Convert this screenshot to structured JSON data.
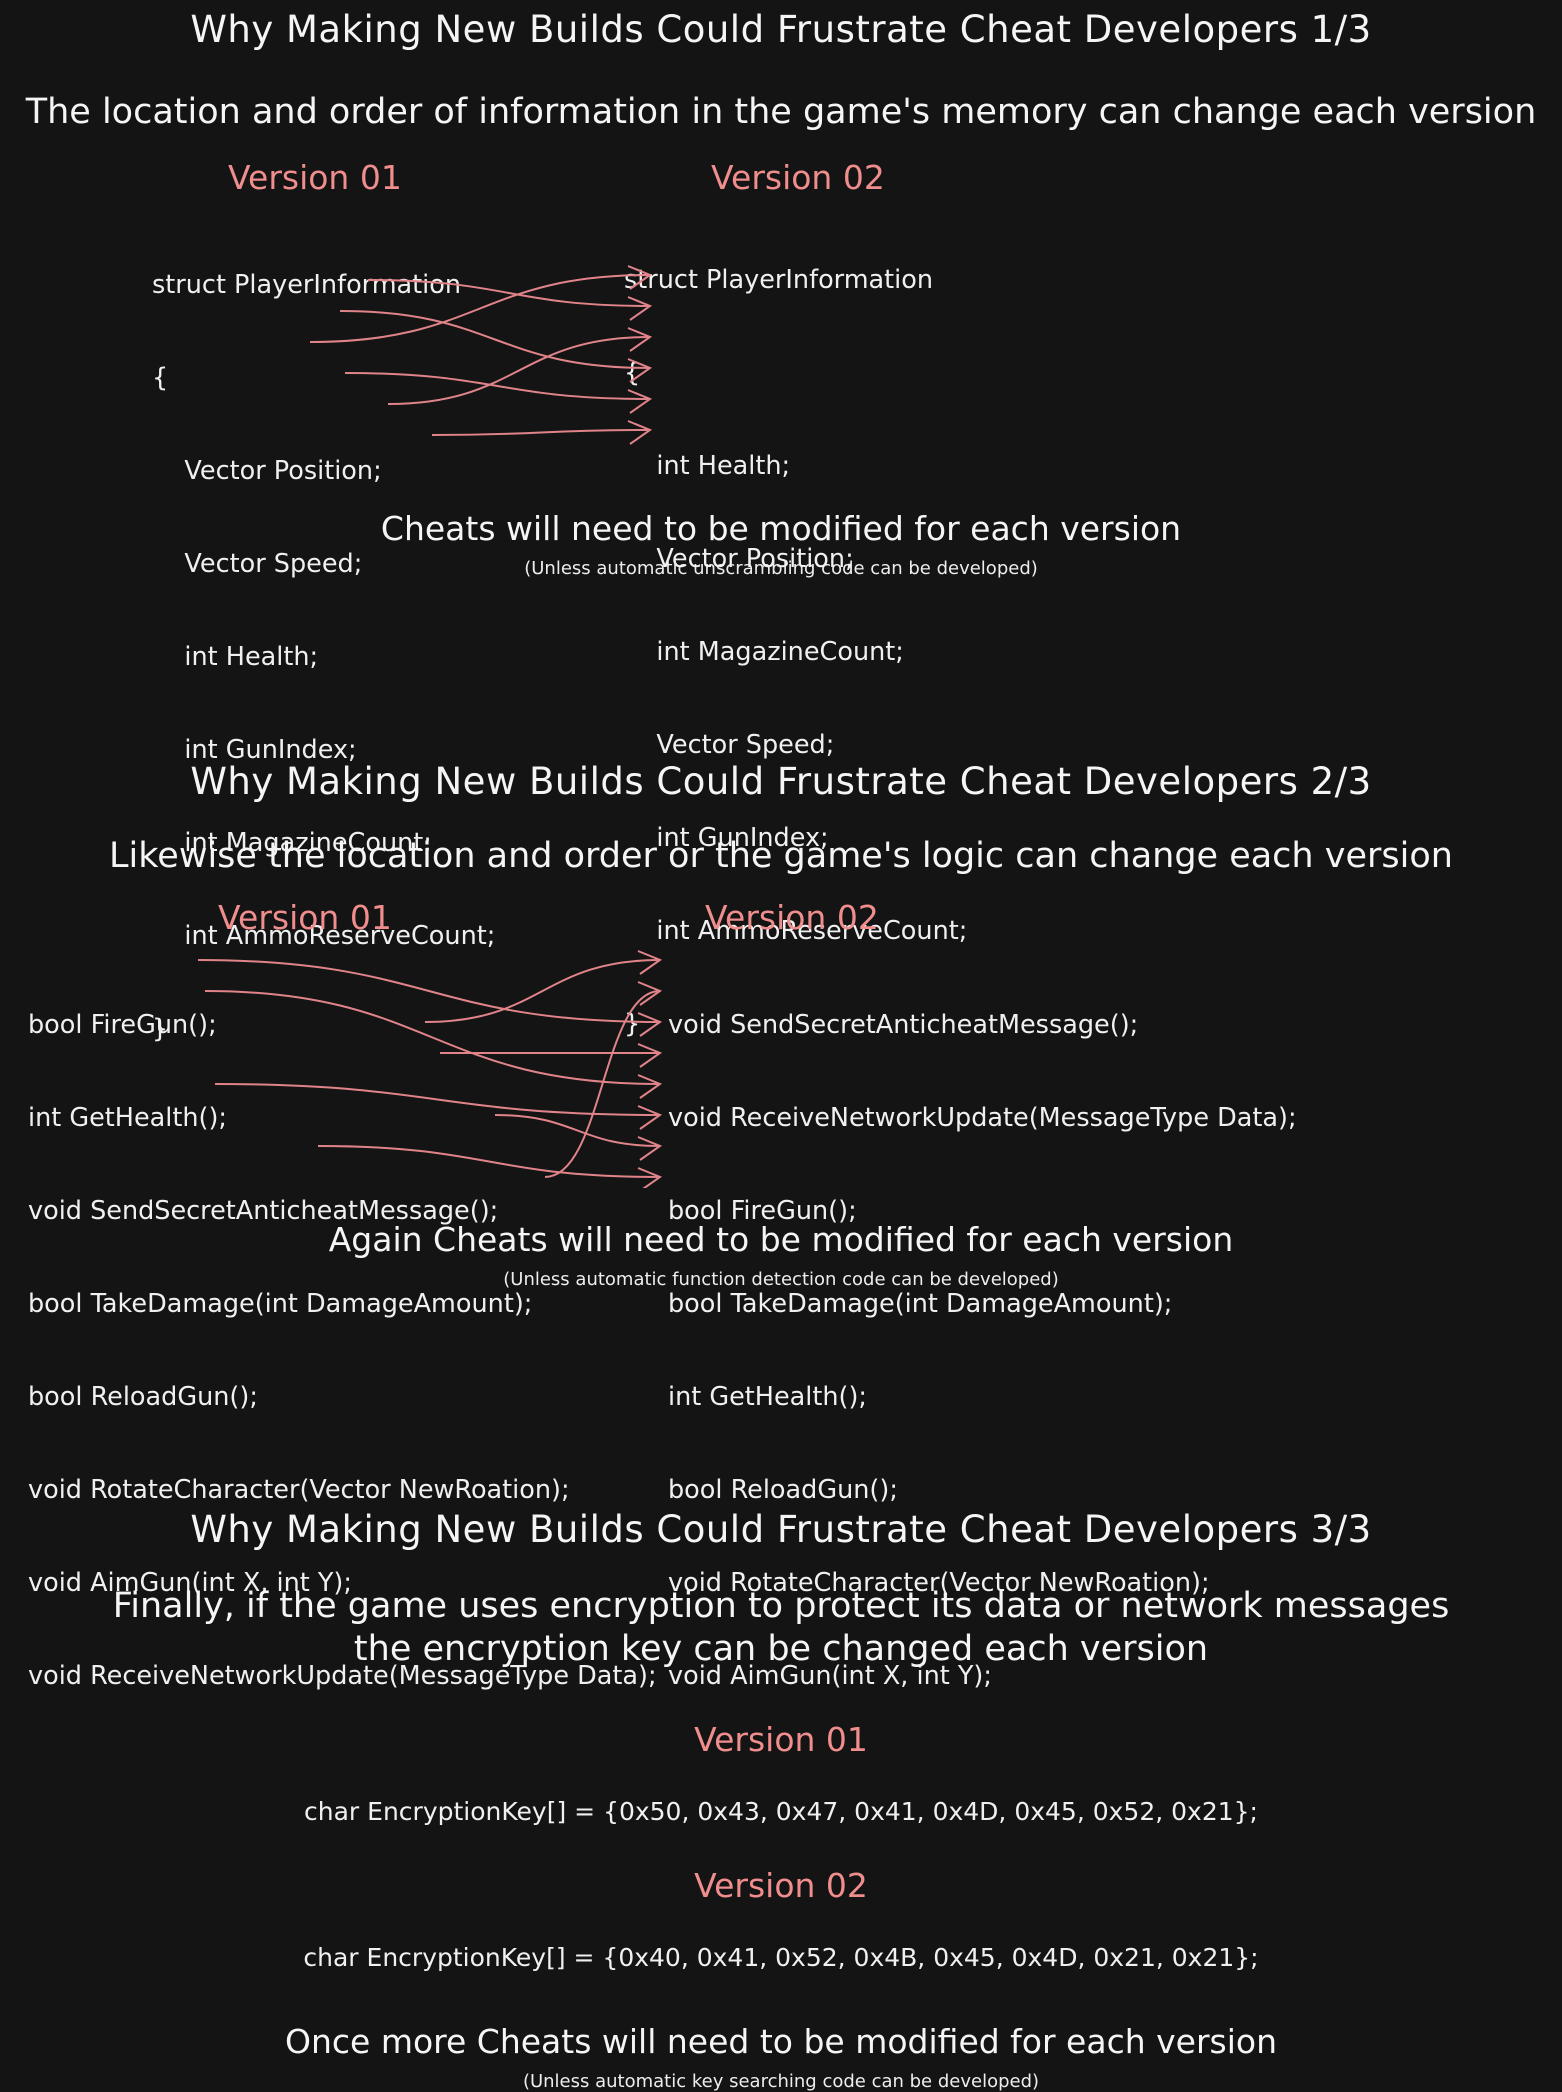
{
  "theme": {
    "background": "#141414",
    "text_color": "#f2f2f2",
    "accent_color": "#f08d8d",
    "arrow_color": "#e0848a"
  },
  "sections": [
    {
      "id": "section-1",
      "title": "Why Making New Builds Could Frustrate Cheat Developers 1/3",
      "subtitle": "The location and order of information in the game's memory can change each version",
      "version_left_label": "Version 01",
      "version_right_label": "Version 02",
      "left_code": [
        "struct PlayerInformation",
        "{",
        "    Vector Position;",
        "    Vector Speed;",
        "    int Health;",
        "    int GunIndex;",
        "    int MagazineCount;",
        "    int AmmoReserveCount;",
        "}"
      ],
      "right_code": [
        "struct PlayerInformation",
        "{",
        "    int Health;",
        "    Vector Position;",
        "    int MagazineCount;",
        "    Vector Speed;",
        "    int GunIndex;",
        "    int AmmoReserveCount;",
        "}"
      ],
      "mapping": [
        {
          "from": 0,
          "to": 1
        },
        {
          "from": 1,
          "to": 3
        },
        {
          "from": 2,
          "to": 0
        },
        {
          "from": 3,
          "to": 4
        },
        {
          "from": 4,
          "to": 2
        },
        {
          "from": 5,
          "to": 5
        }
      ],
      "conclusion": "Cheats will need to be modified for each version",
      "note": "(Unless automatic unscrambling code can be developed)"
    },
    {
      "id": "section-2",
      "title": "Why Making New Builds Could Frustrate Cheat Developers 2/3",
      "subtitle": "Likewise the location and order or the game's logic can change each version",
      "version_left_label": "Version 01",
      "version_right_label": "Version 02",
      "left_code": [
        "bool FireGun();",
        "int GetHealth();",
        "void SendSecretAnticheatMessage();",
        "bool TakeDamage(int DamageAmount);",
        "bool ReloadGun();",
        "void RotateCharacter(Vector NewRoation);",
        "void AimGun(int X, int Y);",
        "void ReceiveNetworkUpdate(MessageType Data);"
      ],
      "right_code": [
        "void SendSecretAnticheatMessage();",
        "void ReceiveNetworkUpdate(MessageType Data);",
        "bool FireGun();",
        "bool TakeDamage(int DamageAmount);",
        "int GetHealth();",
        "bool ReloadGun();",
        "void RotateCharacter(Vector NewRoation);",
        "void AimGun(int X, int Y);"
      ],
      "mapping": [
        {
          "from": 0,
          "to": 2
        },
        {
          "from": 1,
          "to": 4
        },
        {
          "from": 2,
          "to": 0
        },
        {
          "from": 3,
          "to": 3
        },
        {
          "from": 4,
          "to": 5
        },
        {
          "from": 5,
          "to": 6
        },
        {
          "from": 6,
          "to": 7
        },
        {
          "from": 7,
          "to": 1
        }
      ],
      "conclusion": "Again Cheats will need to be modified for each version",
      "note": "(Unless automatic function detection code can be developed)"
    },
    {
      "id": "section-3",
      "title": "Why Making New Builds Could Frustrate Cheat Developers 3/3",
      "subtitle_line_1": "Finally, if the game uses encryption to protect its data or network messages",
      "subtitle_line_2": "the encryption key can be changed each version",
      "version_01_label": "Version 01",
      "version_01_code": "char EncryptionKey[] = {0x50, 0x43, 0x47, 0x41, 0x4D, 0x45, 0x52, 0x21};",
      "version_02_label": "Version 02",
      "version_02_code": "char EncryptionKey[] = {0x40, 0x41, 0x52, 0x4B, 0x45, 0x4D, 0x21, 0x21};",
      "conclusion": "Once more Cheats will need to be modified for each version",
      "note": "(Unless automatic key searching code can be developed)"
    }
  ]
}
